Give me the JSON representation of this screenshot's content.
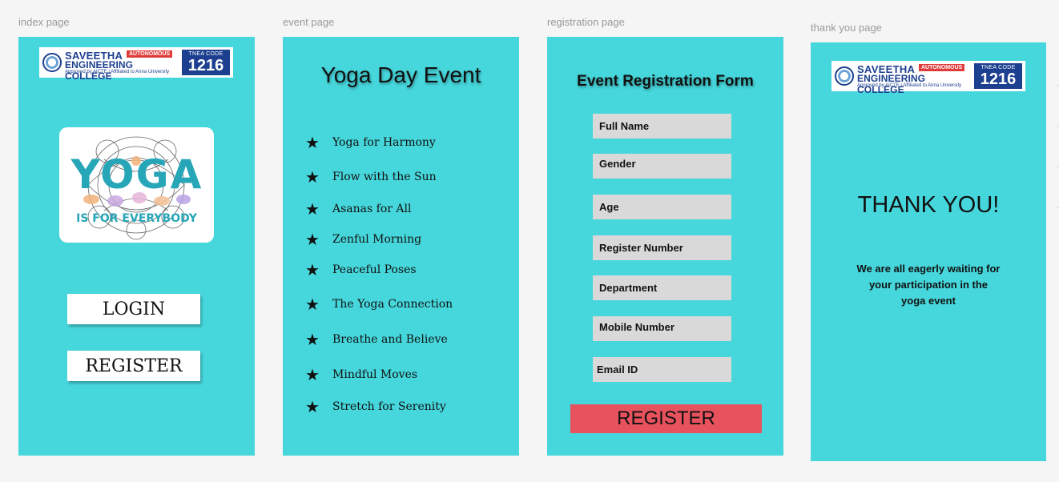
{
  "frames": {
    "index": {
      "label": "index page"
    },
    "event": {
      "label": "event page"
    },
    "registration": {
      "label": "registration page"
    },
    "thankyou": {
      "label": "thank you page"
    }
  },
  "logo": {
    "line1": "SAVEETHA",
    "badge": "AUTONOMOUS",
    "line2": "ENGINEERING COLLEGE",
    "line3": "Approved by AICTE | Affiliated to Anna University",
    "code_label": "TNEA CODE",
    "code_value": "1216"
  },
  "index": {
    "yoga_word": "YOGA",
    "yoga_tagline": "IS FOR EVERYBODY",
    "login_label": "LOGIN",
    "register_label": "REGISTER"
  },
  "event": {
    "title": "Yoga Day Event",
    "bullet_icon": "star-icon",
    "items": [
      "Yoga for Harmony",
      "Flow with the Sun",
      "Asanas for All",
      "Zenful Morning",
      "Peaceful Poses",
      "The Yoga Connection",
      "Breathe and Believe",
      "Mindful Moves",
      "Stretch for Serenity"
    ]
  },
  "registration": {
    "title": "Event Registration Form",
    "fields": [
      "Full Name",
      "Gender",
      "Age",
      "Register Number",
      "Department",
      "Mobile Number",
      "Email ID"
    ],
    "submit_label": "REGISTER"
  },
  "thankyou": {
    "heading": "THANK YOU!",
    "message_lines": [
      "We are all eagerly waiting for",
      "your participation in the",
      "yoga event"
    ]
  },
  "colors": {
    "frame_bg": "#46d7dc",
    "canvas_bg": "#f5f5f5",
    "field_bg": "#d9d9d9",
    "submit_bg": "#e8525d",
    "logo_blue": "#1c3f8f",
    "logo_red": "#e03b3b"
  }
}
